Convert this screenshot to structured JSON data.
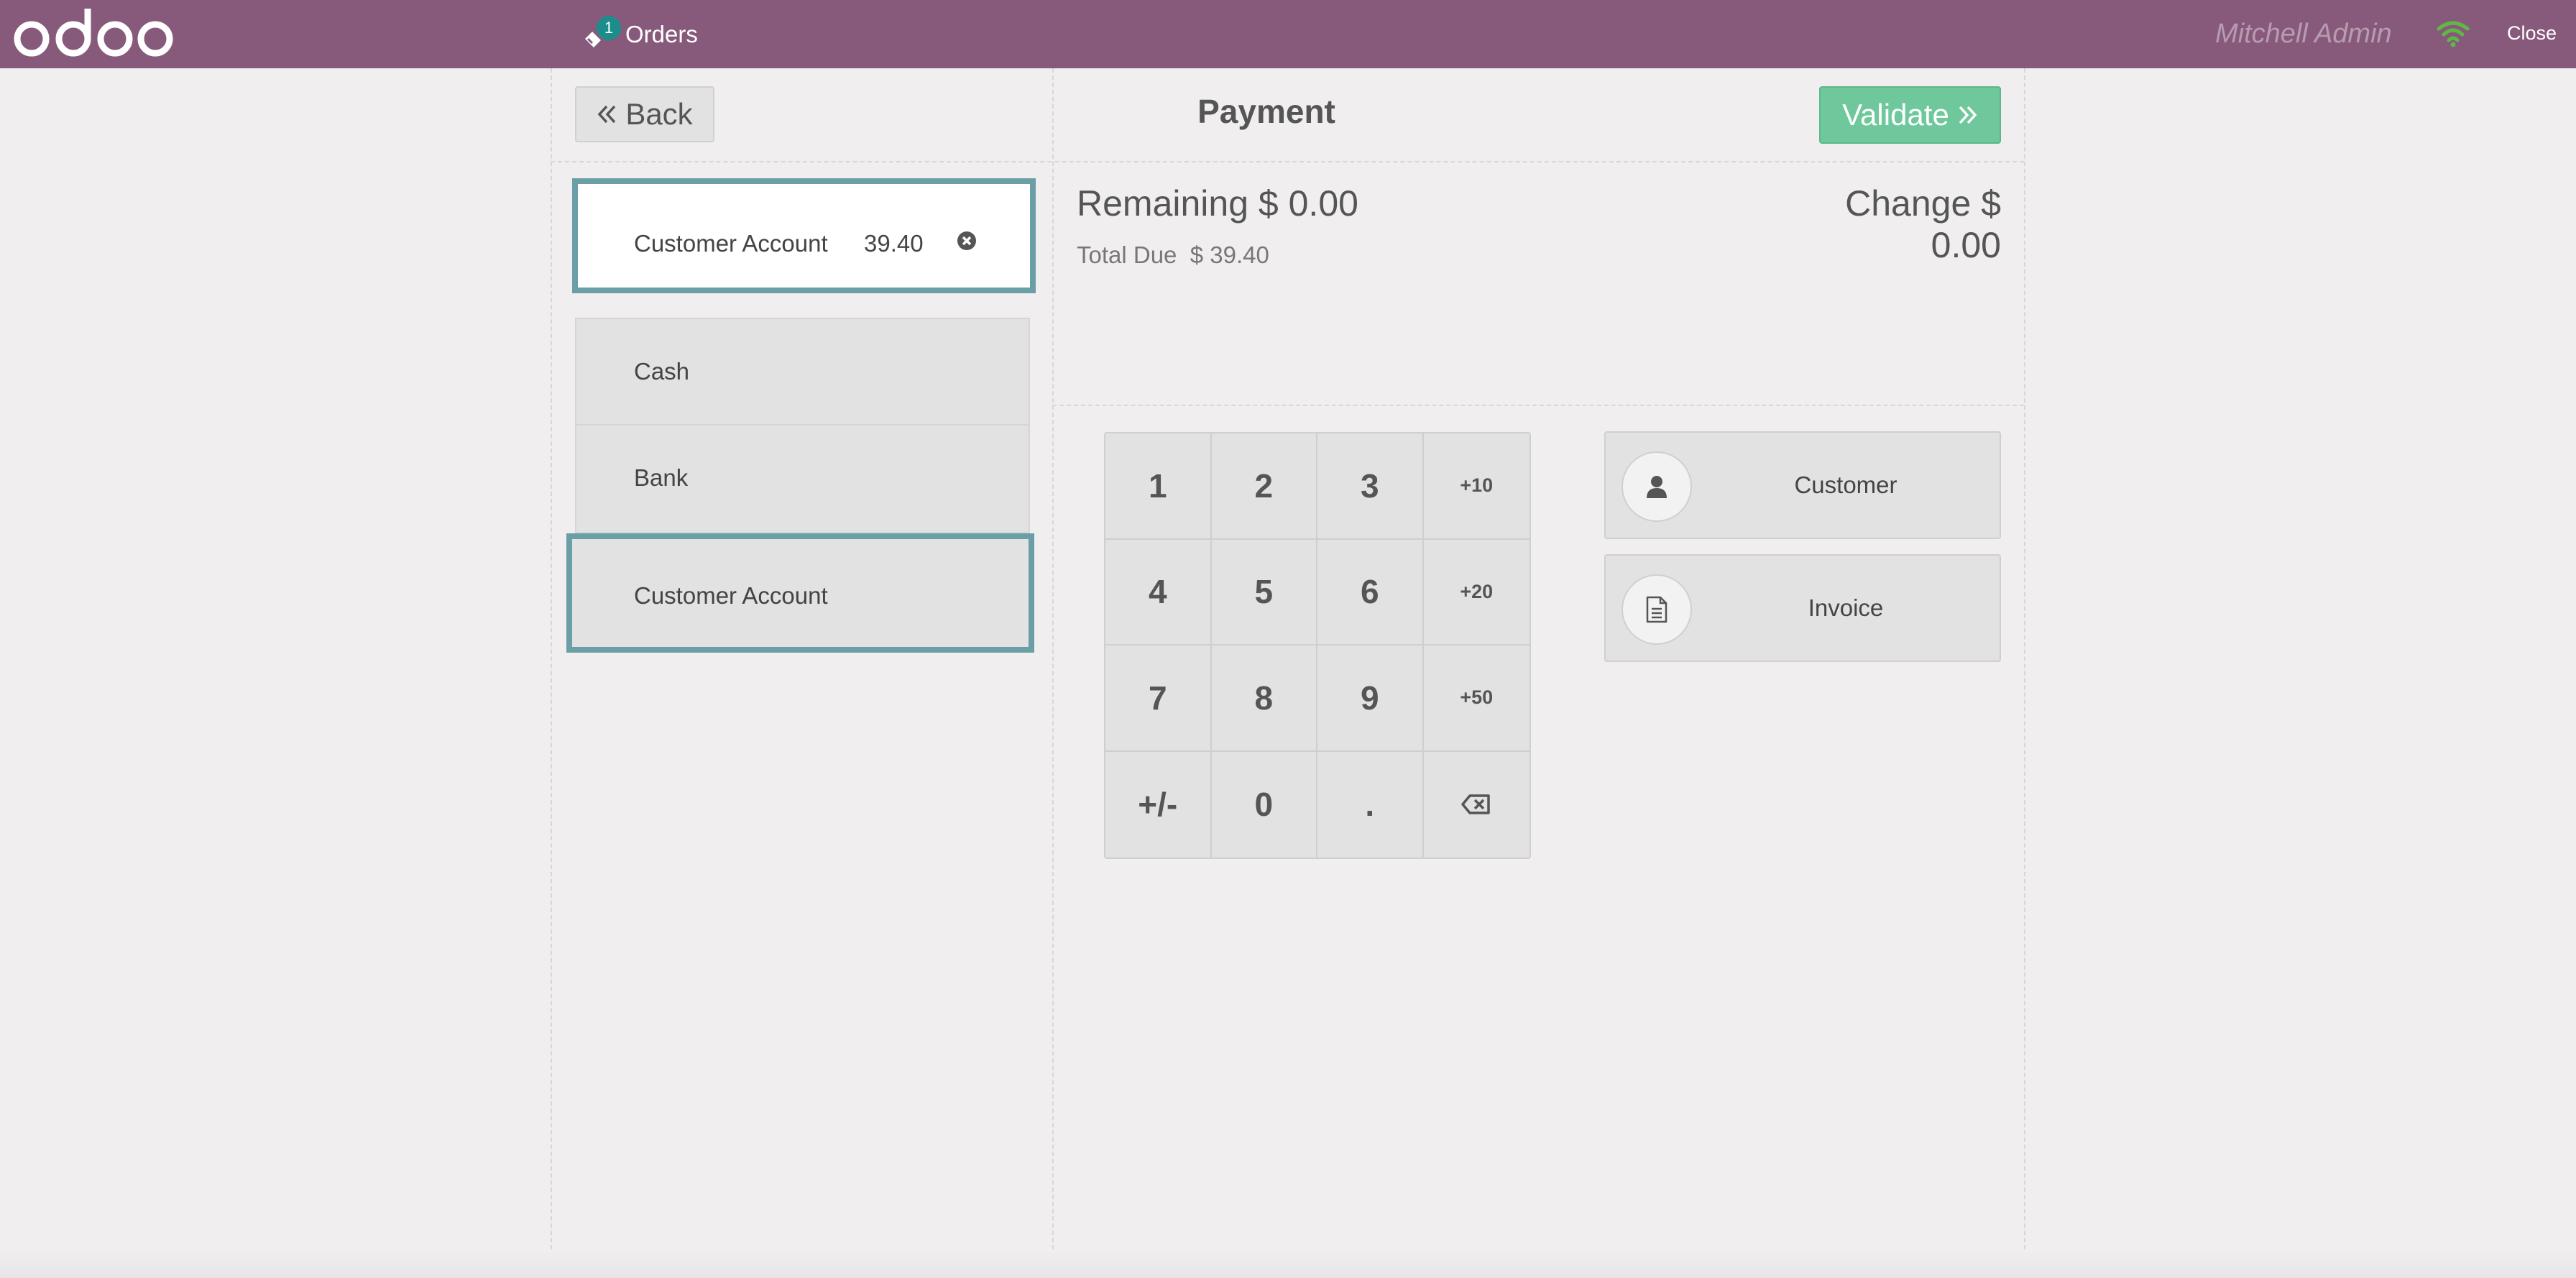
{
  "topbar": {
    "orders_count": "1",
    "orders_label": "Orders",
    "user_name": "Mitchell Admin",
    "close_label": "Close"
  },
  "header": {
    "back_label": "Back",
    "title": "Payment",
    "validate_label": "Validate"
  },
  "payment_lines": [
    {
      "name": "Customer Account",
      "amount": "39.40"
    }
  ],
  "payment_methods": [
    {
      "label": "Cash"
    },
    {
      "label": "Bank"
    },
    {
      "label": "Customer Account"
    }
  ],
  "summary": {
    "remaining_label": "Remaining",
    "remaining_value": "$ 0.00",
    "total_due_label": "Total Due",
    "total_due_value": "$ 39.40",
    "change_label": "Change",
    "change_value": "$ 0.00"
  },
  "numpad": [
    "1",
    "2",
    "3",
    "+10",
    "4",
    "5",
    "6",
    "+20",
    "7",
    "8",
    "9",
    "+50",
    "+/-",
    "0",
    "."
  ],
  "actions": {
    "customer_label": "Customer",
    "invoice_label": "Invoice"
  },
  "colors": {
    "topbar": "#875a7b",
    "accent_border": "#6a9fa7",
    "validate": "#6ec89b",
    "badge": "#1c8d8b",
    "wifi": "#5fb846"
  },
  "icons": [
    "orders-icon",
    "wifi-icon",
    "back-chevron-icon",
    "validate-chevron-icon",
    "remove-line-icon",
    "backspace-icon",
    "user-icon",
    "document-icon"
  ]
}
